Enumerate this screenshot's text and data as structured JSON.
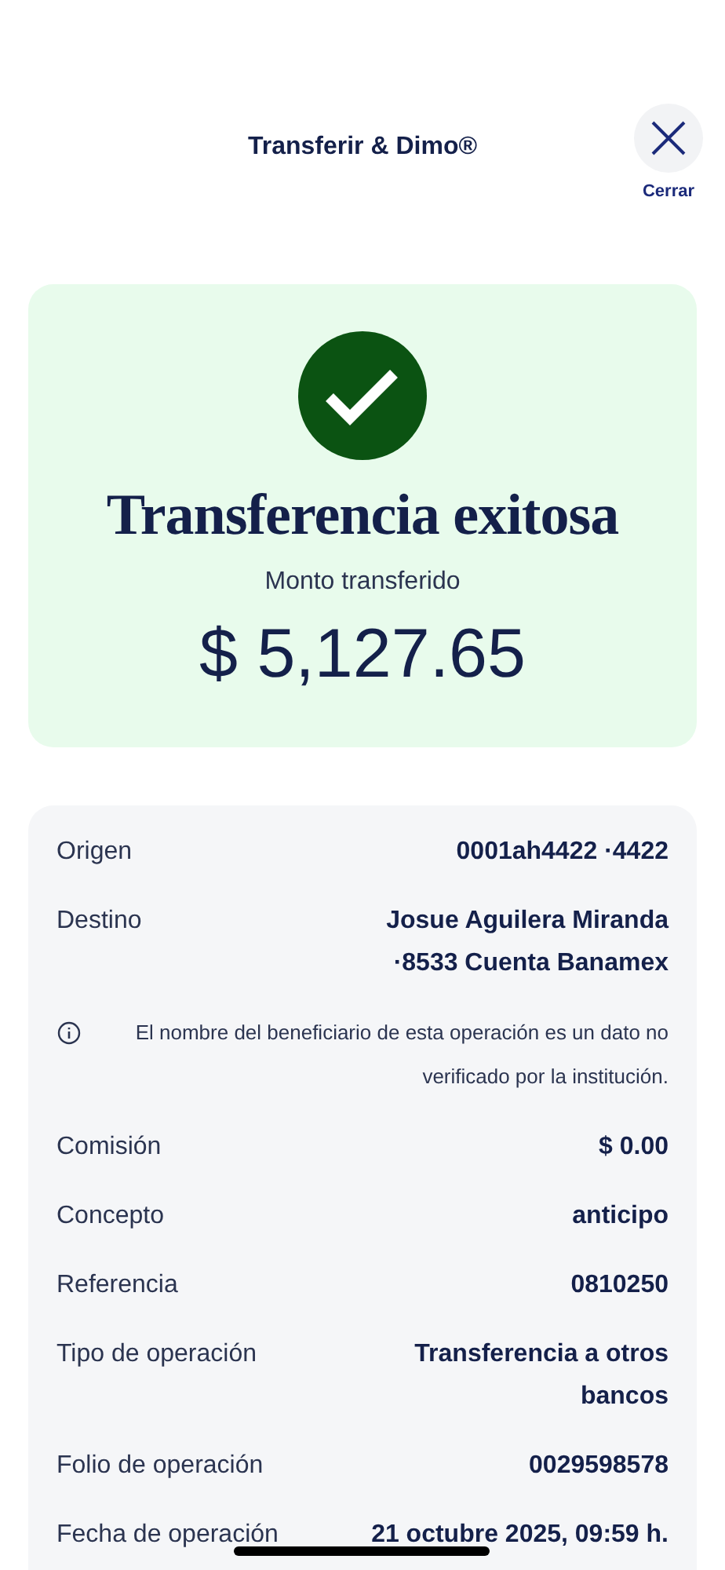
{
  "header": {
    "title": "Transferir & Dimo®",
    "close_label": "Cerrar"
  },
  "result": {
    "title": "Transferencia exitosa",
    "amount_label": "Monto transferido",
    "amount": "$ 5,127.65"
  },
  "details": [
    {
      "kind": "row",
      "label": "Origen",
      "value": "0001ah4422 ·4422"
    },
    {
      "kind": "row",
      "label": "Destino",
      "value": "Josue Aguilera Miranda ·8533 Cuenta Banamex"
    },
    {
      "kind": "note",
      "text": "El nombre del beneficiario de esta operación es un dato no verificado por la institución."
    },
    {
      "kind": "row",
      "label": "Comisión",
      "value": "$ 0.00"
    },
    {
      "kind": "row",
      "label": "Concepto",
      "value": "anticipo"
    },
    {
      "kind": "row",
      "label": "Referencia",
      "value": "0810250"
    },
    {
      "kind": "row",
      "label": "Tipo de operación",
      "value": "Transferencia a otros bancos"
    },
    {
      "kind": "row",
      "label": "Folio de operación",
      "value": "0029598578"
    },
    {
      "kind": "row",
      "label": "Fecha de operación",
      "value": "21 octubre 2025, 09:59 h."
    }
  ]
}
